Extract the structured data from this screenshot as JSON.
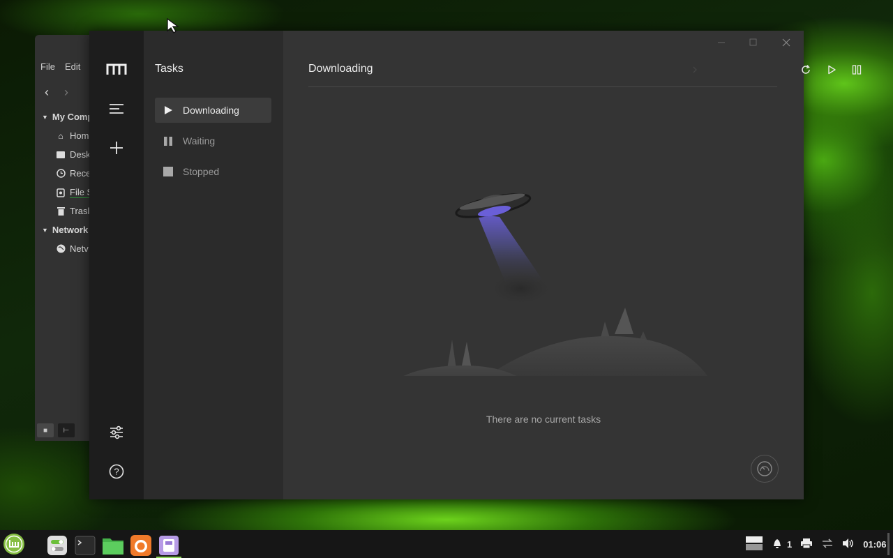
{
  "file_manager": {
    "menu": [
      "File",
      "Edit"
    ],
    "sections": [
      {
        "label": "My Comp",
        "items": [
          {
            "label": "Hom",
            "icon": "home-icon"
          },
          {
            "label": "Desk",
            "icon": "desktop-icon"
          },
          {
            "label": "Rece",
            "icon": "recent-icon"
          },
          {
            "label": "File S",
            "icon": "filesystem-icon"
          },
          {
            "label": "Trasl",
            "icon": "trash-icon"
          }
        ]
      },
      {
        "label": "Network",
        "items": [
          {
            "label": "Netv",
            "icon": "network-icon"
          }
        ]
      }
    ]
  },
  "app": {
    "logo": "motrix-logo-icon",
    "tasks_title": "Tasks",
    "task_filters": [
      {
        "label": "Downloading",
        "icon": "play-icon",
        "active": true
      },
      {
        "label": "Waiting",
        "icon": "pause-icon",
        "active": false
      },
      {
        "label": "Stopped",
        "icon": "stop-icon",
        "active": false
      }
    ],
    "content_title": "Downloading",
    "empty_message": "There are no current tasks",
    "toolbar": [
      "refresh-icon",
      "resume-all-icon",
      "pause-all-icon"
    ],
    "colors": {
      "rail": "#1d1d1d",
      "panel": "#2b2b2b",
      "content": "#343434",
      "ufo_beam": "#6a5fd8"
    }
  },
  "taskbar": {
    "notification_count": "1",
    "clock": "01:06"
  }
}
